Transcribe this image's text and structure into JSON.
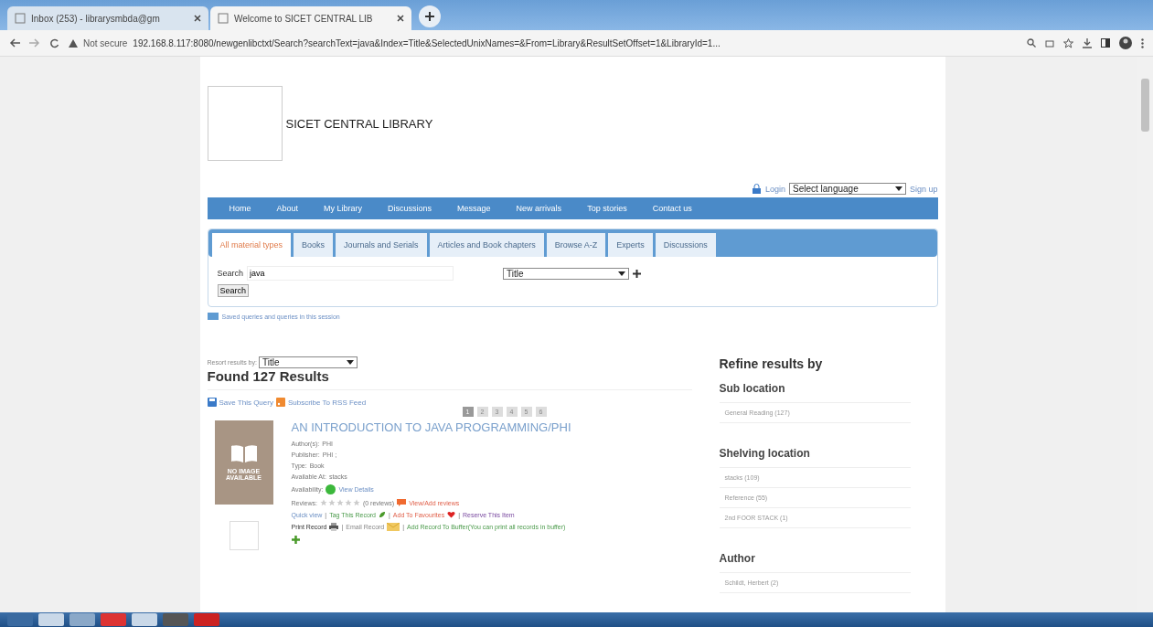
{
  "browser": {
    "tabs": [
      {
        "title": "Inbox (253) - librarysmbda@gm",
        "selected": false
      },
      {
        "title": "Welcome to SICET CENTRAL LIB",
        "selected": true
      }
    ],
    "security": "Not secure",
    "url": "192.168.8.117:8080/newgenlibctxt/Search?searchText=java&Index=Title&SelectedUnixNames=&From=Library&ResultSetOffset=1&LibraryId=1..."
  },
  "site": {
    "title": "SICET CENTRAL LIBRARY",
    "login": "Login",
    "language": "Select language",
    "signup": "Sign up"
  },
  "nav": [
    "Home",
    "About",
    "My Library",
    "Discussions",
    "Message",
    "New arrivals",
    "Top stories",
    "Contact us"
  ],
  "material_tabs": [
    {
      "label": "All material types",
      "selected": true
    },
    {
      "label": "Books",
      "selected": false
    },
    {
      "label": "Journals and Serials",
      "selected": false
    },
    {
      "label": "Articles and Book chapters",
      "selected": false
    },
    {
      "label": "Browse A-Z",
      "selected": false
    },
    {
      "label": "Experts",
      "selected": false
    },
    {
      "label": "Discussions",
      "selected": false
    }
  ],
  "search": {
    "label": "Search",
    "value": "java",
    "index": "Title",
    "button": "Search"
  },
  "saved_queries": "Saved queries and queries in this session",
  "results": {
    "resort_label": "Resort results by:",
    "resort_value": "Title",
    "found": "Found 127 Results",
    "save_query": "Save This Query",
    "rss": "Subscribe To RSS Feed",
    "pages": [
      {
        "label": "1",
        "selected": true
      },
      {
        "label": "2",
        "selected": false
      },
      {
        "label": "3",
        "selected": false
      },
      {
        "label": "4",
        "selected": false
      },
      {
        "label": "5",
        "selected": false
      },
      {
        "label": "6",
        "selected": false
      }
    ],
    "item": {
      "title": "AN INTRODUCTION TO JAVA PROGRAMMING/PHI",
      "cover_text": "NO IMAGE AVAILABLE",
      "fields": [
        {
          "label": "Author(s):",
          "value": "PHI"
        },
        {
          "label": "Publisher:",
          "value": "PHI ;"
        },
        {
          "label": "Type:",
          "value": "Book"
        },
        {
          "label": "Available At:",
          "value": "stacks"
        }
      ],
      "availability_label": "Availability:",
      "view_details": "View Details",
      "reviews_label": "Reviews:",
      "stars": 0,
      "review_count": "(0 reviews)",
      "view_reviews": "View/Add reviews",
      "separator": "|",
      "actions": [
        {
          "text": "Quick view",
          "kind": "link"
        },
        {
          "text": "Tag This Record",
          "kind": "tag"
        },
        {
          "text": "Add To Favourites",
          "kind": "favourite"
        },
        {
          "text": "Reserve This Item",
          "kind": "reserve"
        }
      ],
      "actions2": [
        {
          "text": "Print Record",
          "kind": "print"
        },
        {
          "text": "Email Record",
          "kind": "email"
        },
        {
          "text": "Add Record To Buffer(You can print all records in buffer)",
          "kind": "buffer"
        }
      ]
    }
  },
  "refine": {
    "title": "Refine results by",
    "groups": [
      {
        "heading": "Sub location",
        "items": [
          "General Reading (127)"
        ]
      },
      {
        "heading": "Shelving location",
        "items": [
          "stacks (109)",
          "Reference (55)",
          "2nd FOOR STACK (1)"
        ]
      },
      {
        "heading": "Author",
        "items": [
          "Schildt, Herbert (2)"
        ]
      }
    ]
  }
}
